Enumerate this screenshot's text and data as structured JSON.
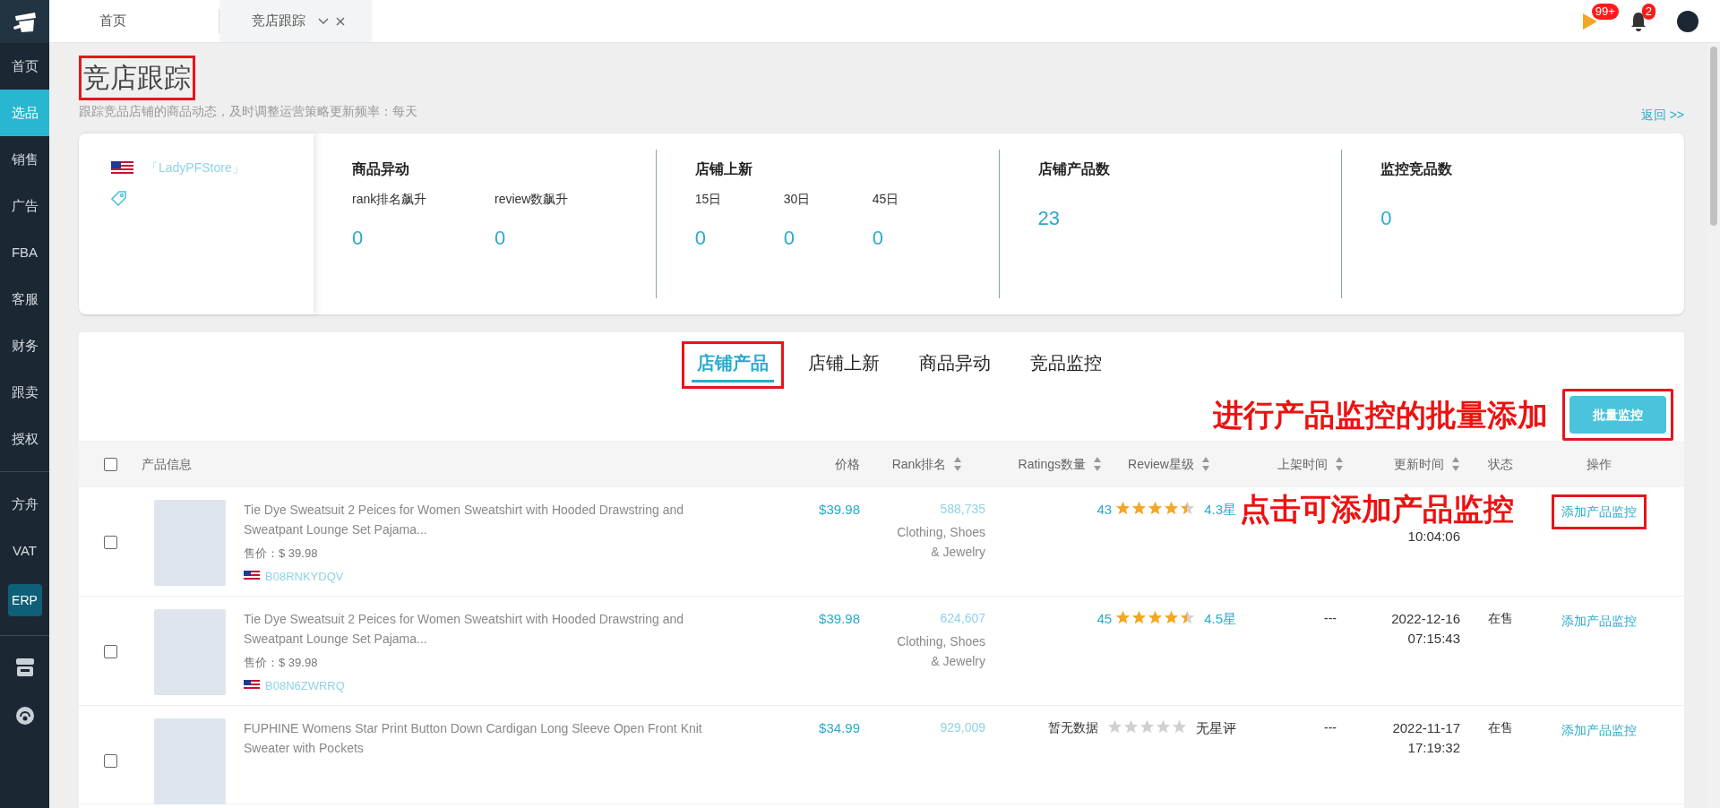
{
  "sidebar": {
    "items": [
      {
        "label": "首页",
        "kind": "text",
        "selected": false
      },
      {
        "label": "选品",
        "kind": "text",
        "selected": true
      },
      {
        "label": "销售",
        "kind": "text",
        "selected": false
      },
      {
        "label": "广告",
        "kind": "text",
        "selected": false
      },
      {
        "label": "FBA",
        "kind": "text",
        "selected": false
      },
      {
        "label": "客服",
        "kind": "text",
        "selected": false
      },
      {
        "label": "财务",
        "kind": "text",
        "selected": false
      },
      {
        "label": "跟卖",
        "kind": "text",
        "selected": false
      },
      {
        "label": "授权",
        "kind": "text",
        "selected": false
      },
      {
        "kind": "divider"
      },
      {
        "label": "方舟",
        "kind": "text",
        "selected": false
      },
      {
        "label": "VAT",
        "kind": "text",
        "selected": false
      },
      {
        "label": "ERP",
        "kind": "badge",
        "selected": false
      },
      {
        "kind": "divider"
      }
    ]
  },
  "tabs": [
    {
      "label": "首页",
      "selected": false,
      "closable": false
    },
    {
      "label": "竞店跟踪",
      "selected": true,
      "closable": true
    }
  ],
  "header": {
    "flag_badge": "99+",
    "bell_badge": "2"
  },
  "page": {
    "title": "竞店跟踪",
    "title_highlighted": true,
    "subtitle": "跟踪竞品店铺的商品动态，及时调整运营策略更新频率：每天",
    "back_link": "返回 >>"
  },
  "store": {
    "name": "「LadyPFStore」"
  },
  "stats": [
    {
      "title": "商品异动",
      "metrics": [
        {
          "label": "rank排名飙升",
          "value": "0"
        },
        {
          "label": "review数飙升",
          "value": "0"
        }
      ]
    },
    {
      "title": "店铺上新",
      "metrics": [
        {
          "label": "15日",
          "value": "0"
        },
        {
          "label": "30日",
          "value": "0"
        },
        {
          "label": "45日",
          "value": "0"
        }
      ]
    },
    {
      "title": "店铺产品数",
      "metrics": [
        {
          "value": "23"
        }
      ]
    },
    {
      "title": "监控竞品数",
      "metrics": [
        {
          "value": "0"
        }
      ]
    }
  ],
  "content_tabs": [
    {
      "label": "店铺产品",
      "selected": true,
      "highlighted": true
    },
    {
      "label": "店铺上新",
      "selected": false,
      "highlighted": false
    },
    {
      "label": "商品异动",
      "selected": false,
      "highlighted": false
    },
    {
      "label": "竞品监控",
      "selected": false,
      "highlighted": false
    }
  ],
  "batch_button": {
    "label": "批量监控",
    "highlighted": true
  },
  "annotations": [
    "进行产品监控的批量添加",
    "点击可添加产品监控"
  ],
  "table": {
    "select_all": {
      "checked": false
    },
    "columns": [
      {
        "label": "产品信息",
        "sortable": false
      },
      {
        "label": "价格",
        "sortable": false
      },
      {
        "label": "Rank排名",
        "sortable": true
      },
      {
        "label": "Ratings数量",
        "sortable": true
      },
      {
        "label": "Review星级",
        "sortable": true
      },
      {
        "label": "上架时间",
        "sortable": true
      },
      {
        "label": "更新时间",
        "sortable": true
      },
      {
        "label": "状态",
        "sortable": false
      },
      {
        "label": "操作",
        "sortable": false
      }
    ],
    "rows": [
      {
        "checked": false,
        "title": "Tie Dye Sweatsuit 2 Peices for Women Sweatshirt with Hooded Drawstring and Sweatpant Lounge Set Pajama...",
        "sale_price": "售价：$ 39.98",
        "asin": "B08RNKYDQV",
        "price": "$39.98",
        "rank": "588,735",
        "category": "Clothing, Shoes & Jewelry",
        "ratings": "43",
        "stars": 4.5,
        "rating_text": "4.3星",
        "updated": [
          "10:04:06"
        ],
        "action": "添加产品监控",
        "action_highlighted": true
      },
      {
        "checked": false,
        "title": "Tie Dye Sweatsuit 2 Peices for Women Sweatshirt with Hooded Drawstring and Sweatpant Lounge Set Pajama...",
        "sale_price": "售价：$ 39.98",
        "asin": "B08N6ZWRRQ",
        "price": "$39.98",
        "rank": "624,607",
        "category": "Clothing, Shoes & Jewelry",
        "ratings": "45",
        "stars": 4.5,
        "rating_text": "4.5星",
        "listed": "---",
        "updated": [
          "2022-12-16",
          "07:15:43"
        ],
        "status": "在售",
        "action": "添加产品监控",
        "action_highlighted": false
      },
      {
        "checked": false,
        "title": "FUPHINE Womens Star Print Button Down Cardigan Long Sleeve Open Front Knit Sweater with Pockets",
        "price": "$34.99",
        "rank": "929,009",
        "ratings_empty": "暂无数据",
        "stars": 0,
        "rating_text": "无星评",
        "listed": "---",
        "updated": [
          "2022-11-17",
          "17:19:32"
        ],
        "status": "在售",
        "action": "添加产品监控",
        "action_highlighted": false
      }
    ]
  }
}
